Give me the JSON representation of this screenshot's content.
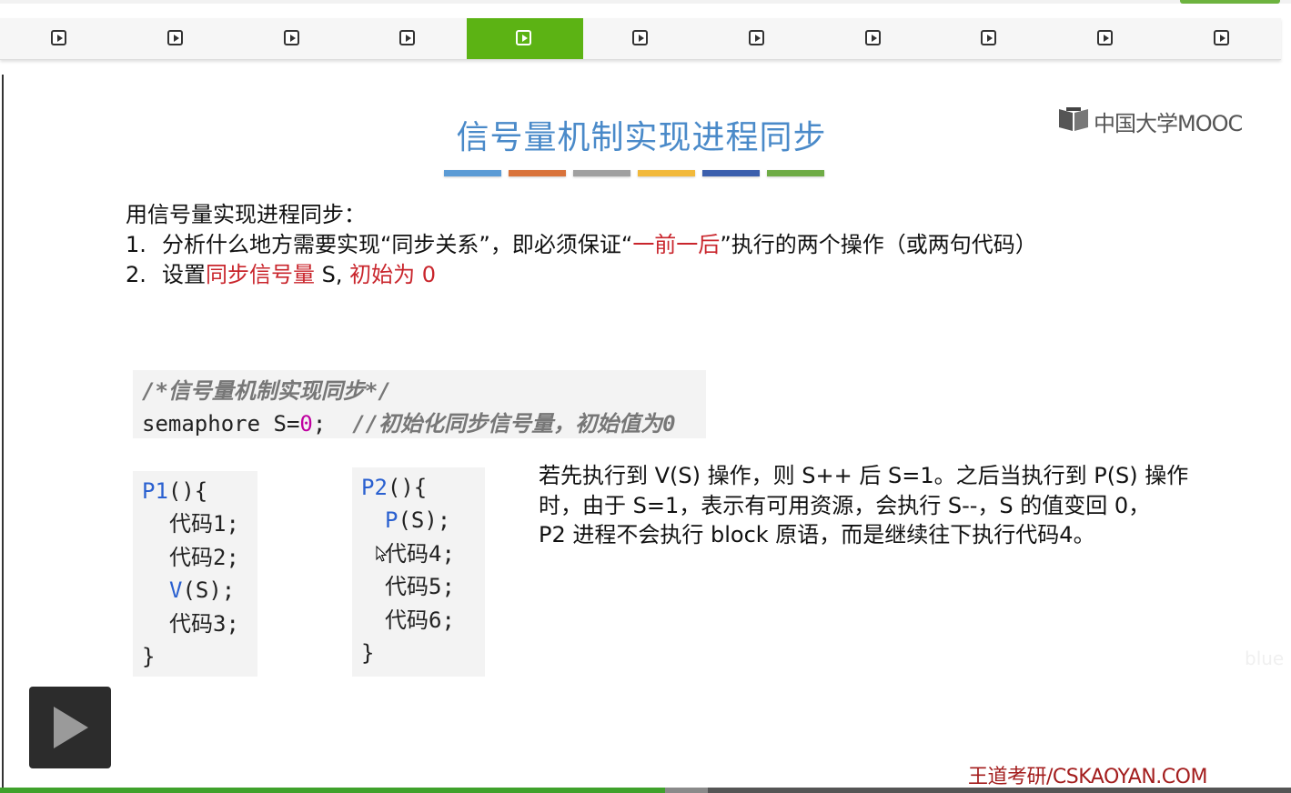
{
  "nav": {
    "items": [
      {
        "icon": "play-square-icon",
        "active": false
      },
      {
        "icon": "play-square-icon",
        "active": false
      },
      {
        "icon": "play-square-icon",
        "active": false
      },
      {
        "icon": "play-square-icon",
        "active": false
      },
      {
        "icon": "play-square-icon",
        "active": true
      },
      {
        "icon": "play-square-icon",
        "active": false
      },
      {
        "icon": "play-square-icon",
        "active": false
      },
      {
        "icon": "play-square-icon",
        "active": false
      },
      {
        "icon": "play-square-icon",
        "active": false
      },
      {
        "icon": "play-square-icon",
        "active": false
      },
      {
        "icon": "play-square-icon",
        "active": false
      }
    ],
    "active_color": "#5cb314"
  },
  "slide": {
    "title": "信号量机制实现进程同步",
    "title_color": "#4a8ac9",
    "bar_colors": [
      "#5b9bd5",
      "#d9733b",
      "#a0a0a0",
      "#f2b93b",
      "#3b5fad",
      "#6fac46"
    ],
    "logo_text": "中国大学MOOC",
    "intro": "用信号量实现进程同步：",
    "step1": {
      "num": "1.",
      "text_a": "分析什么地方需要实现“同步关系”，即必须保证“",
      "text_red": "一前一后",
      "text_b": "”执行的两个操作（或两句代码）"
    },
    "step2": {
      "num": "2.",
      "text_a": "设置",
      "text_red1": "同步信号量",
      "text_b": " S, ",
      "text_red2": "初始为 0"
    },
    "code_decl": {
      "comment1": "/*信号量机制实现同步*/",
      "kw": "semaphore S=",
      "val": "0",
      "semi": ";",
      "comment2": "//初始化同步信号量，初始值为0"
    },
    "p1_code": {
      "head_name": "P1",
      "head_rest": "(){",
      "l1": "代码1;",
      "l2": "代码2;",
      "l3_fn": "V",
      "l3_rest": "(S);",
      "l4": "代码3;",
      "close": "}"
    },
    "p2_code": {
      "head_name": "P2",
      "head_rest": "(){",
      "l1_fn": "P",
      "l1_rest": "(S);",
      "l2": "代码4;",
      "l3": "代码5;",
      "l4": "代码6;",
      "close": "}"
    },
    "explain": [
      "若先执行到 V(S) 操作，则 S++ 后 S=1。之后当执行到 P(S) 操作",
      "时，由于 S=1，表示有可用资源，会执行 S--，S 的值变回 0，",
      "P2 进程不会执行 block 原语，而是继续往下执行代码4。"
    ],
    "watermark": "blue",
    "footer_brand": "王道考研/CSKAOYAN.COM"
  },
  "player": {
    "play_icon": "play-icon",
    "progress": 0.515,
    "buffered": 0.548
  }
}
